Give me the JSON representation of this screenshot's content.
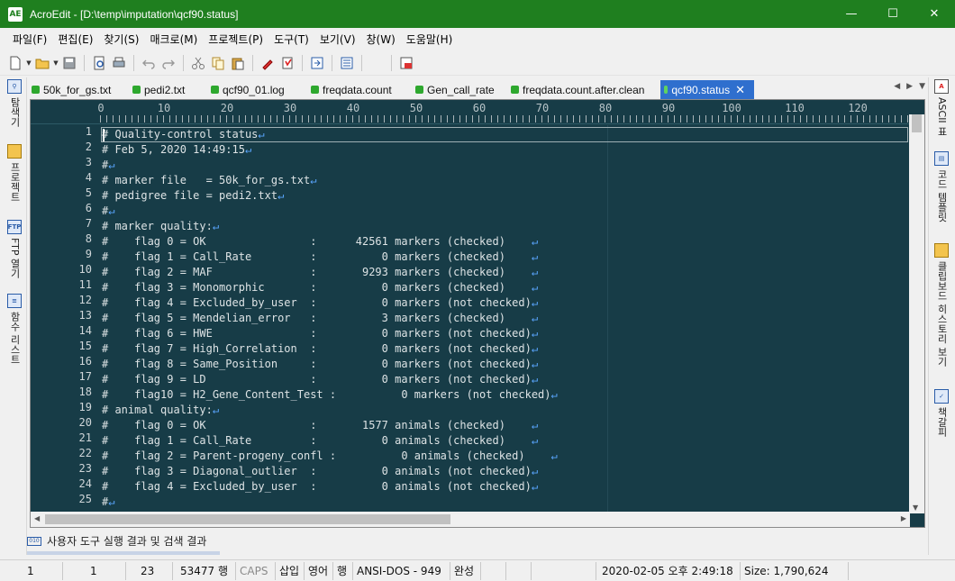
{
  "window": {
    "title": "AcroEdit - [D:\\temp\\imputation\\qcf90.status]",
    "app_icon": "AE",
    "controls": [
      "minimize-icon",
      "maximize-icon",
      "close-icon"
    ]
  },
  "menu": [
    "파일(F)",
    "편집(E)",
    "찾기(S)",
    "매크로(M)",
    "프로젝트(P)",
    "도구(T)",
    "보기(V)",
    "창(W)",
    "도움말(H)"
  ],
  "toolbar_icons": [
    "new-file-icon",
    "open-folder-icon",
    "save-icon",
    "print-preview-icon",
    "print-icon",
    "undo-icon",
    "redo-icon",
    "cut-icon",
    "copy-icon",
    "paste-icon",
    "highlighter-icon",
    "bookmark-icon",
    "goto-icon",
    "list-icon",
    "column-icon"
  ],
  "left_panel": [
    {
      "icon": "search-icon",
      "label": "탐색기"
    },
    {
      "icon": "project-icon",
      "label": "프로젝트"
    },
    {
      "icon": "ftp-icon",
      "icon_text": "FTP",
      "label": "FTP 열기"
    },
    {
      "icon": "function-list-icon",
      "label": "함수 리스트"
    }
  ],
  "right_panel": [
    {
      "icon": "ascii-icon",
      "icon_text": "A",
      "label": "ASCII 표"
    },
    {
      "icon": "code-template-icon",
      "label": "코드 템플릿"
    },
    {
      "icon": "clipboard-icon",
      "label": "클립보드 히스토리 보기"
    },
    {
      "icon": "bookmark-list-icon",
      "label": "책갈피"
    }
  ],
  "tabs": [
    {
      "label": "50k_for_gs.txt",
      "active": false
    },
    {
      "label": "pedi2.txt",
      "active": false
    },
    {
      "label": "qcf90_01.log",
      "active": false
    },
    {
      "label": "freqdata.count",
      "active": false
    },
    {
      "label": "Gen_call_rate",
      "active": false
    },
    {
      "label": "freqdata.count.after.clean",
      "active": false
    },
    {
      "label": "qcf90.status",
      "active": true
    }
  ],
  "tab_close": "✕",
  "ruler": [
    "0",
    "10",
    "20",
    "30",
    "40",
    "50",
    "60",
    "70",
    "80",
    "90",
    "100",
    "110",
    "120"
  ],
  "eol_marker": "↵",
  "lines": [
    "# Quality-control status",
    "# Feb 5, 2020 14:49:15",
    "#",
    "# marker file   = 50k_for_gs.txt",
    "# pedigree file = pedi2.txt",
    "#",
    "# marker quality:",
    "#    flag 0 = OK                :      42561 markers (checked)    ",
    "#    flag 1 = Call_Rate         :          0 markers (checked)    ",
    "#    flag 2 = MAF               :       9293 markers (checked)    ",
    "#    flag 3 = Monomorphic       :          0 markers (checked)    ",
    "#    flag 4 = Excluded_by_user  :          0 markers (not checked)",
    "#    flag 5 = Mendelian_error   :          3 markers (checked)    ",
    "#    flag 6 = HWE               :          0 markers (not checked)",
    "#    flag 7 = High_Correlation  :          0 markers (not checked)",
    "#    flag 8 = Same_Position     :          0 markers (not checked)",
    "#    flag 9 = LD                :          0 markers (not checked)",
    "#    flag10 = H2_Gene_Content_Test :          0 markers (not checked)",
    "# animal quality:",
    "#    flag 0 = OK                :       1577 animals (checked)    ",
    "#    flag 1 = Call_Rate         :          0 animals (checked)    ",
    "#    flag 2 = Parent-progeny_confl :          0 animals (checked)    ",
    "#    flag 3 = Diagonal_outlier  :          0 animals (not checked)",
    "#    flag 4 = Excluded_by_user  :          0 animals (not checked)",
    "#"
  ],
  "output_panel": {
    "label": "사용자 도구 실행 결과 및 검색 결과",
    "icon": "output-icon"
  },
  "status": {
    "line": "1",
    "col": "1",
    "total_lines": "23",
    "line_count": "53477 행",
    "caps": "CAPS",
    "insert": "삽입",
    "lang": "영어",
    "mode": "행",
    "encoding": "ANSI-DOS - 949",
    "complete": "완성",
    "datetime": "2020-02-05 오후 2:49:18",
    "size": "Size: 1,790,624"
  }
}
